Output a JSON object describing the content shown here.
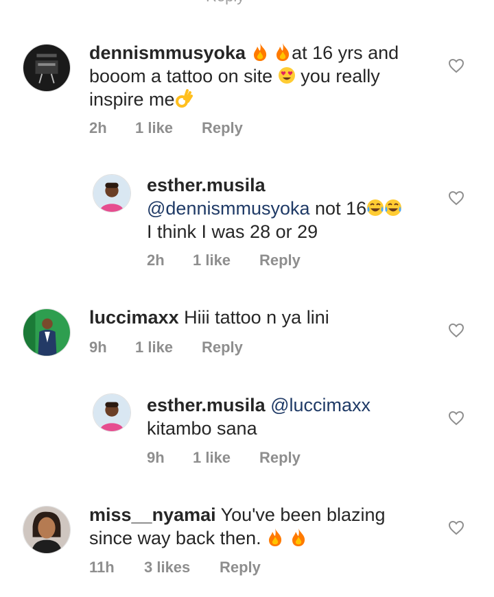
{
  "top_clipped": "Reply",
  "comments": [
    {
      "username": "dennismmusyoka",
      "text_a": "at 16 yrs and booom a tattoo on site",
      "text_b": "you really inspire me",
      "time": "2h",
      "likes": "1 like",
      "reply": "Reply",
      "emojis": [
        "fire-emoji",
        "fire-emoji",
        "heart-eyes-emoji",
        "ok-hand-emoji"
      ]
    },
    {
      "username": "esther.musila",
      "mention": "@dennismmusyoka",
      "text_a": "not 16",
      "text_b": "I think I was 28 or 29",
      "time": "2h",
      "likes": "1 like",
      "reply": "Reply",
      "emojis": [
        "tears-of-joy-emoji",
        "tears-of-joy-emoji"
      ]
    },
    {
      "username": "luccimaxx",
      "text_a": "Hiii tattoo n ya lini",
      "time": "9h",
      "likes": "1 like",
      "reply": "Reply"
    },
    {
      "username": "esther.musila",
      "mention": "@luccimaxx",
      "text_a": "kitambo sana",
      "time": "9h",
      "likes": "1 like",
      "reply": "Reply"
    },
    {
      "username": "miss__nyamai",
      "text_a": "You've been blazing since way back then.",
      "time": "11h",
      "likes": "3 likes",
      "reply": "Reply",
      "emojis": [
        "fire-emoji",
        "fire-emoji"
      ]
    }
  ],
  "colors": {
    "text": "#262626",
    "meta": "#8e8e8e",
    "mention": "#1f3a66"
  }
}
